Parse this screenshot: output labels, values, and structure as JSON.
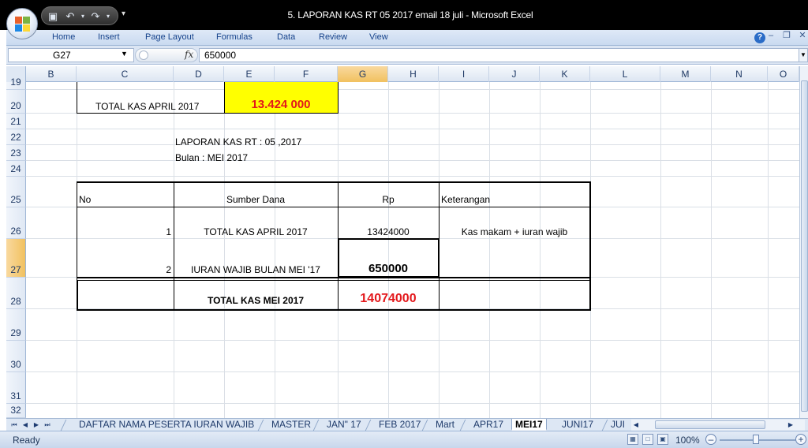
{
  "window": {
    "title": "5. LAPORAN KAS   RT 05 2017 email 18 juli  -  Microsoft Excel"
  },
  "quick_access": {
    "save_icon": "save-icon",
    "undo_icon": "undo-icon",
    "redo_icon": "redo-icon"
  },
  "ribbon": {
    "tabs": [
      "Home",
      "Insert",
      "Page Layout",
      "Formulas",
      "Data",
      "Review",
      "View"
    ]
  },
  "formula_bar": {
    "name_box": "G27",
    "fx": "fx",
    "value": "650000"
  },
  "grid": {
    "columns": [
      "B",
      "C",
      "D",
      "E",
      "F",
      "G",
      "H",
      "I",
      "J",
      "K",
      "L",
      "M",
      "N",
      "O"
    ],
    "selected_column": "G",
    "rows": [
      "19",
      "20",
      "21",
      "22",
      "23",
      "24",
      "25",
      "26",
      "27",
      "28",
      "29",
      "30",
      "31",
      "32"
    ],
    "selected_row": "27"
  },
  "cells": {
    "c20": "TOTAL KAS  APRIL 2017",
    "e20": "13.424 000",
    "d22": "LAPORAN KAS RT : 05 ,2017",
    "d23": "Bulan    : MEI   2017",
    "th_no": "No",
    "th_sumber": "Sumber Dana",
    "th_rp": "Rp",
    "th_ket": "Keterangan",
    "r1_no": "1",
    "r1_sumber": "TOTAL KAS APRIL 2017",
    "r1_rp": "13424000",
    "r1_ket": "Kas makam + iuran wajib",
    "r2_no": "2",
    "r2_sumber": "IURAN WAJIB BULAN MEI '17",
    "r2_rp": "650000",
    "total_label": "TOTAL KAS  MEI 2017",
    "total_rp": "14074000"
  },
  "colors": {
    "highlight_yellow": "#ffff00",
    "red_text": "#e3171b"
  },
  "sheet_tabs": [
    {
      "label": "DAFTAR NAMA PESERTA IURAN WAJIB",
      "active": false
    },
    {
      "label": "MASTER",
      "active": false
    },
    {
      "label": "JAN\" 17",
      "active": false
    },
    {
      "label": "FEB 2017",
      "active": false
    },
    {
      "label": "Mart",
      "active": false
    },
    {
      "label": "APR17",
      "active": false
    },
    {
      "label": "MEI17",
      "active": true
    },
    {
      "label": "JUNI17",
      "active": false
    },
    {
      "label": "JUI",
      "active": false
    }
  ],
  "status_bar": {
    "status": "Ready",
    "zoom": "100%"
  }
}
